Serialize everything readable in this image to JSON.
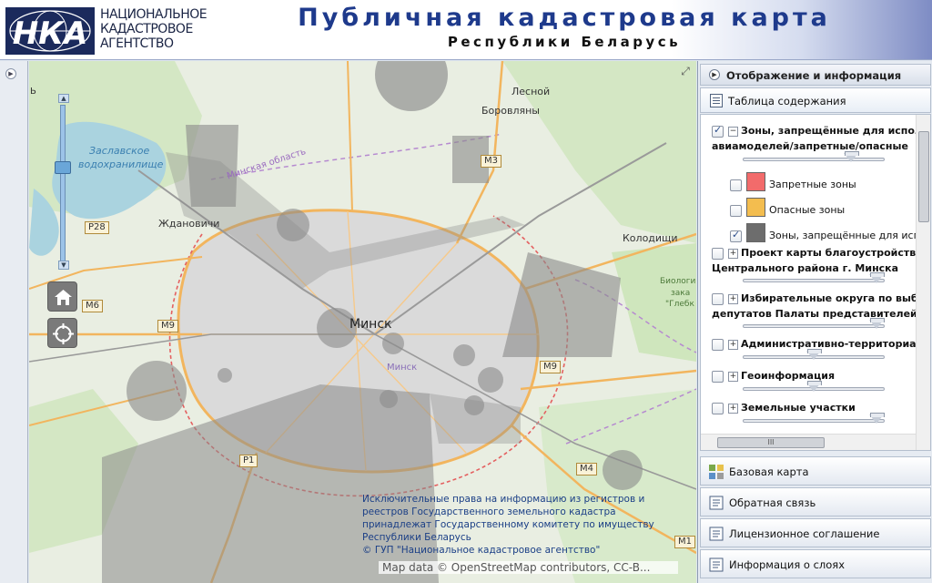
{
  "header": {
    "logo_text": "НКА",
    "agency_lines": [
      "НАЦИОНАЛЬНОЕ",
      "КАДАСТРОВОЕ",
      "АГЕНТСТВО"
    ],
    "title": "Публичная кадастровая карта",
    "subtitle": "Республики Беларусь"
  },
  "map": {
    "labels": {
      "lesnoy": "Лесной",
      "borovlyany": "Боровляны",
      "zaslavskoe1": "Заславское",
      "zaslavskoe2": "водохранилище",
      "minsk_oblast": "Минская область",
      "zhdanovichi": "Ждановичи",
      "minsk": "Минск",
      "minsk_small": "Минск",
      "kolodishchi": "Колодищи",
      "bio1": "Биологи",
      "bio2": "зака",
      "bio3": "\"Глебк",
      "edge_char": "Ь"
    },
    "road_shields": {
      "m3": "M3",
      "p28": "P28",
      "m6": "M6",
      "m9a": "M9",
      "m9b": "M9",
      "p1": "P1",
      "m4": "M4",
      "m1": "M1"
    },
    "controls": {
      "home_icon": "home-icon",
      "locate_icon": "crosshair-icon",
      "zoom_level_fraction": 0.6
    },
    "attribution_lines": [
      "Исключительные права на информацию из регистров и",
      "реестров Государственного земельного кадастра",
      "принадлежат Государственному комитету по имуществу",
      "Республики Беларусь",
      "© ГУП \"Национальное кадастровое агентство\""
    ],
    "osm_attribution": "Map data © OpenStreetMap contributors, CC-B..."
  },
  "panel": {
    "header_title": "Отображение и информация",
    "toc_title": "Таблица содержания",
    "layers": [
      {
        "name_lines": [
          "Зоны, запрещённые для испол",
          "авиамоделей/запретные/опасные"
        ],
        "checked": true,
        "expanded": true,
        "opacity": 0.82
      },
      {
        "name_lines": [
          "Проект карты благоустройства",
          "Центрального района г. Минска"
        ],
        "checked": false,
        "expanded": false,
        "opacity": 0.97
      },
      {
        "name_lines": [
          "Избирательные округа по выбо",
          "депутатов Палаты представителей"
        ],
        "checked": false,
        "expanded": false,
        "opacity": 0.97
      },
      {
        "name_lines": [
          "Административно-территориал"
        ],
        "checked": false,
        "expanded": false,
        "opacity": 0.5
      },
      {
        "name_lines": [
          "Геоинформация"
        ],
        "checked": false,
        "expanded": false,
        "opacity": 0.5
      },
      {
        "name_lines": [
          "Земельные участки"
        ],
        "checked": false,
        "expanded": false,
        "opacity": 0.97
      }
    ],
    "sublayers": [
      {
        "name": "Запретные зоны",
        "color": "#f26b6b",
        "checked": false
      },
      {
        "name": "Опасные зоны",
        "color": "#f3bd4f",
        "checked": false
      },
      {
        "name": "Зоны, запрещённые для испол",
        "color": "#6d6d6d",
        "checked": true
      }
    ],
    "hscroll_grip": "III",
    "accordion": [
      {
        "label": "Базовая карта",
        "icon": "basemap-icon"
      },
      {
        "label": "Обратная связь",
        "icon": "feedback-icon"
      },
      {
        "label": "Лицензионное соглашение",
        "icon": "document-icon"
      },
      {
        "label": "Информация о слоях",
        "icon": "layers-info-icon"
      }
    ]
  },
  "colors": {
    "title_blue": "#1e3a8c",
    "restricted_gray": "#8a8a8a",
    "water": "#aad3df",
    "forest": "#cfe6c0",
    "urban": "#dcdcdc",
    "road_orange": "#f2b55e"
  }
}
